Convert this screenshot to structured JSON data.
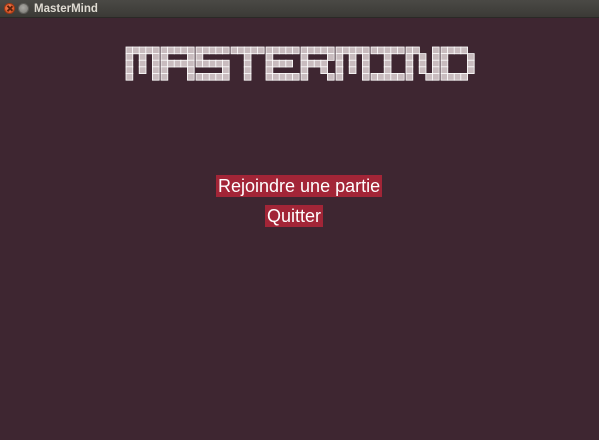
{
  "window": {
    "title": "MasterMind"
  },
  "logo": {
    "text": "MASTERMIND",
    "color": "#c9bcbf",
    "outline": "#ffffff"
  },
  "menu": {
    "join_label": "Rejoindre une partie",
    "quit_label": "Quitter",
    "button_color": "#a22537",
    "text_color": "#ffffff"
  },
  "colors": {
    "background": "#3e2631"
  }
}
